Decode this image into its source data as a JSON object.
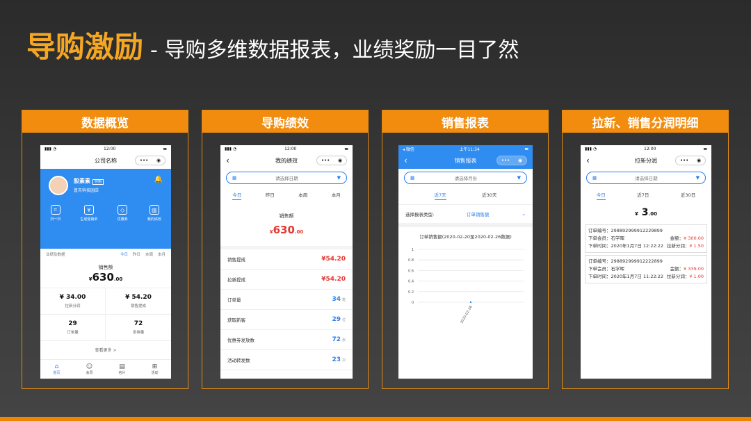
{
  "slide": {
    "title_accent": "导购激励",
    "title_rest": "- 导购多维数据报表，业绩奖励一目了然"
  },
  "panels": [
    {
      "title": "数据概览"
    },
    {
      "title": "导购绩效"
    },
    {
      "title": "销售报表"
    },
    {
      "title": "拉新、销售分润明细"
    }
  ],
  "phone1": {
    "time": "12:00",
    "nav_title": "公司名称",
    "user_name": "股素素",
    "user_tag": "导购",
    "store": "普天科技园店",
    "actions": [
      "扫一扫",
      "生成促销单",
      "优惠券",
      "我的绩效"
    ],
    "section_label": "业绩及数据",
    "range_tabs": [
      "今日",
      "昨日",
      "本周",
      "本月"
    ],
    "sales_label": "销售额",
    "sales_currency": "¥",
    "sales_int": "630",
    "sales_dec": ".00",
    "stats": [
      {
        "value": "¥ 34.00",
        "label": "拉新分润"
      },
      {
        "value": "¥ 54.20",
        "label": "销售提成"
      },
      {
        "value": "29",
        "label": "订单量"
      },
      {
        "value": "72",
        "label": "发券量"
      }
    ],
    "more": "查看更多 >",
    "tabbar": [
      "首页",
      "会员",
      "名片",
      "活动"
    ]
  },
  "phone2": {
    "time": "12:00",
    "nav_title": "我的绩效",
    "date_placeholder": "请选择日期",
    "tabs": [
      "今日",
      "昨日",
      "本周",
      "本月"
    ],
    "sales_label": "销售额",
    "sales_currency": "¥",
    "sales_int": "630",
    "sales_dec": ".00",
    "rows": [
      {
        "label": "销售提成",
        "value": "¥54.20",
        "unit": ""
      },
      {
        "label": "拉新提成",
        "value": "¥54.20",
        "unit": ""
      },
      {
        "label": "订单量",
        "value": "34",
        "unit": "笔"
      },
      {
        "label": "获取新客",
        "value": "29",
        "unit": "位"
      },
      {
        "label": "优惠券发放数",
        "value": "72",
        "unit": "张"
      },
      {
        "label": "活动转发数",
        "value": "23",
        "unit": "次"
      }
    ]
  },
  "phone3": {
    "carrier": "◂ 微信",
    "time": "上午11:34",
    "nav_title": "销售报表",
    "month_placeholder": "请选择月份",
    "tabs": [
      "近7天",
      "近30天"
    ],
    "type_label": "选择报表类型:",
    "type_value": "订单销售额",
    "chart_data": {
      "type": "line",
      "title": "订单销售额(2020-02-20至2020-02-26数据)",
      "x": [
        "2020-02-26"
      ],
      "values": [
        0
      ],
      "ylim": [
        0,
        1
      ],
      "yticks": [
        "1",
        "0.8",
        "0.6",
        "0.4",
        "0.2",
        "0"
      ],
      "grid": true
    }
  },
  "phone4": {
    "time": "12:00",
    "nav_title": "拉新分润",
    "date_placeholder": "请选择日期",
    "tabs": [
      "今日",
      "近7日",
      "近30日"
    ],
    "amount_currency": "¥",
    "amount_int": "3",
    "amount_dec": ".00",
    "orders": [
      {
        "order_no": "订单编号：298892999912229899",
        "member": "下单会员：石学晖",
        "amount_label": "金额：",
        "amount": "¥ 300.00",
        "time": "下单时间：2020年1月7日 12:22:22",
        "share_label": "拉新分润：",
        "share": "¥ 1.50"
      },
      {
        "order_no": "订单编号：298892999912222899",
        "member": "下单会员：石学晖",
        "amount_label": "金额：",
        "amount": "¥ 339.00",
        "time": "下单时间：2020年1月7日 11:22:22",
        "share_label": "拉新分润：",
        "share": "¥ 1.00"
      }
    ]
  }
}
